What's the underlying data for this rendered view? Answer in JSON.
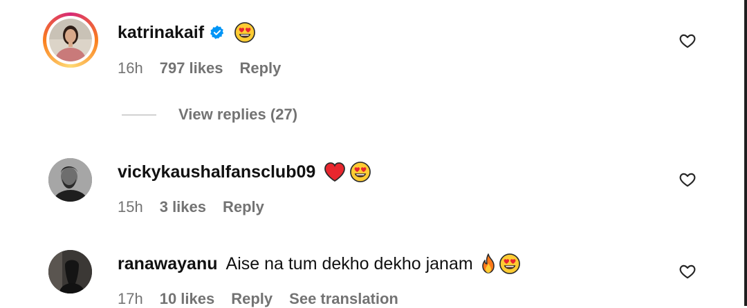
{
  "comments": [
    {
      "username": "katrinakaif",
      "verified": true,
      "text": "",
      "emojis": [
        "heart-eyes-emoji"
      ],
      "time": "16h",
      "likes": "797 likes",
      "reply": "Reply",
      "view_replies": "View replies (27)",
      "avatar_ring": true
    },
    {
      "username": "vickykaushalfansclub09",
      "verified": false,
      "text": "",
      "emojis": [
        "red-heart-emoji",
        "heart-eyes-emoji"
      ],
      "time": "15h",
      "likes": "3 likes",
      "reply": "Reply"
    },
    {
      "username": "ranawayanu",
      "verified": false,
      "text": "Aise na tum dekho dekho janam",
      "emojis": [
        "fire-emoji",
        "heart-eyes-emoji"
      ],
      "time": "17h",
      "likes": "10 likes",
      "reply": "Reply",
      "see_translation": "See translation"
    }
  ],
  "colors": {
    "meta_text": "#737373",
    "verified_blue": "#0095f6",
    "ring_start": "#feda75",
    "ring_end": "#d62976"
  }
}
